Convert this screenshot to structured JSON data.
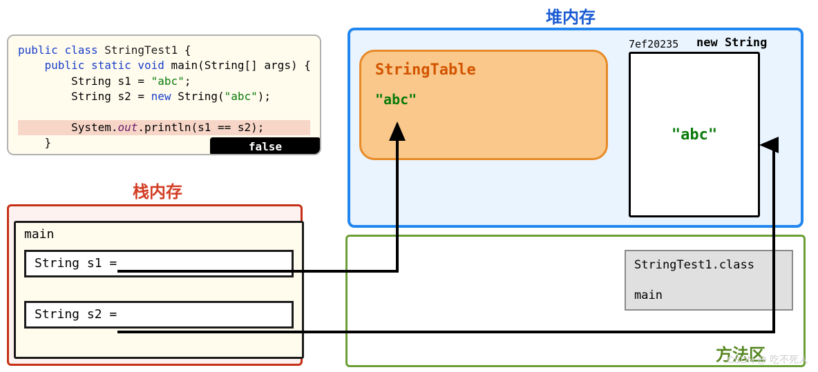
{
  "code": {
    "line1_kw1": "public",
    "line1_kw2": "class",
    "line1_cls": "StringTest1",
    "line1_brace": " {",
    "line2_pre": "    ",
    "line2_kw1": "public static void",
    "line2_name": " main(String[] args) {",
    "line3": "        String s1 = ",
    "line3_str": "\"abc\"",
    "line3_end": ";",
    "line4_a": "        String s2 = ",
    "line4_kw": "new",
    "line4_b": " String(",
    "line4_str": "\"abc\"",
    "line4_end": ");",
    "line6_a": "        System.",
    "line6_it": "out",
    "line6_b": ".println(s1 == s2);",
    "line7": "    }",
    "line8": "}",
    "output": "false"
  },
  "stack": {
    "label": "栈内存",
    "frame_name": "main",
    "var1": "String s1 = ",
    "var2": "String s2 = "
  },
  "heap": {
    "label": "堆内存",
    "string_table_title": "StringTable",
    "string_table_value": "\"abc\"",
    "new_string_addr": "7ef20235",
    "new_string_label": "new String",
    "new_string_value": "\"abc\""
  },
  "method_area": {
    "label": "方法区",
    "class_name": "StringTest1.class",
    "method_name": "main"
  },
  "watermark": "CSDN @ 吃不死人"
}
